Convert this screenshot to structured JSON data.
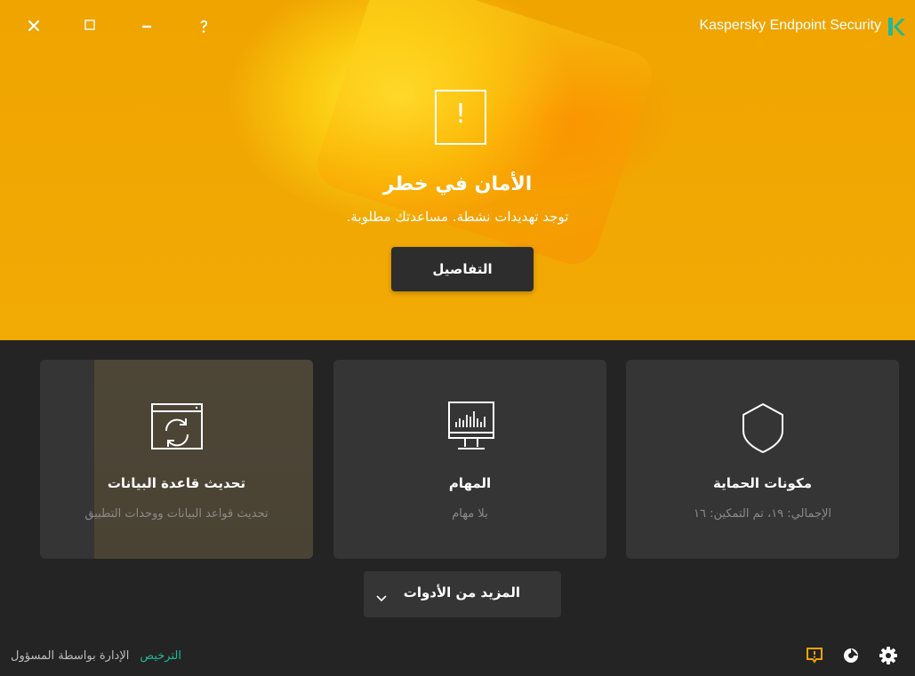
{
  "window": {
    "app_title": "Kaspersky Endpoint Security",
    "controls": [
      "close-icon",
      "maximize-icon",
      "minimize-icon",
      "help-icon"
    ]
  },
  "hero": {
    "status_icon": "exclamation-icon",
    "title": "الأمان في خطر",
    "subtitle": "توجد تهديدات نشطة. مساعدتك مطلوبة.",
    "details_button": "التفاصيل",
    "accent_color": "#f0a400"
  },
  "cards": {
    "protection": {
      "icon": "shield-icon",
      "title": "مكونات الحماية",
      "subtitle": "الإجمالي: ١٩، تم التمكين: ١٦"
    },
    "tasks": {
      "icon": "monitor-chart-icon",
      "title": "المهام",
      "subtitle": "بلا مهام"
    },
    "update": {
      "icon": "refresh-window-icon",
      "title": "تحديث قاعدة البيانات",
      "subtitle": "تحديث قواعد البيانات ووحدات التطبيق"
    }
  },
  "more_tools": {
    "label": "المزيد من الأدوات",
    "icon": "chevron-down-icon"
  },
  "footer": {
    "license_link": "الترخيص",
    "admin_link": "الإدارة بواسطة المسؤول",
    "license_color": "#1fb996",
    "icons": [
      "notification-alert-icon",
      "support-icon",
      "settings-gear-icon"
    ]
  }
}
